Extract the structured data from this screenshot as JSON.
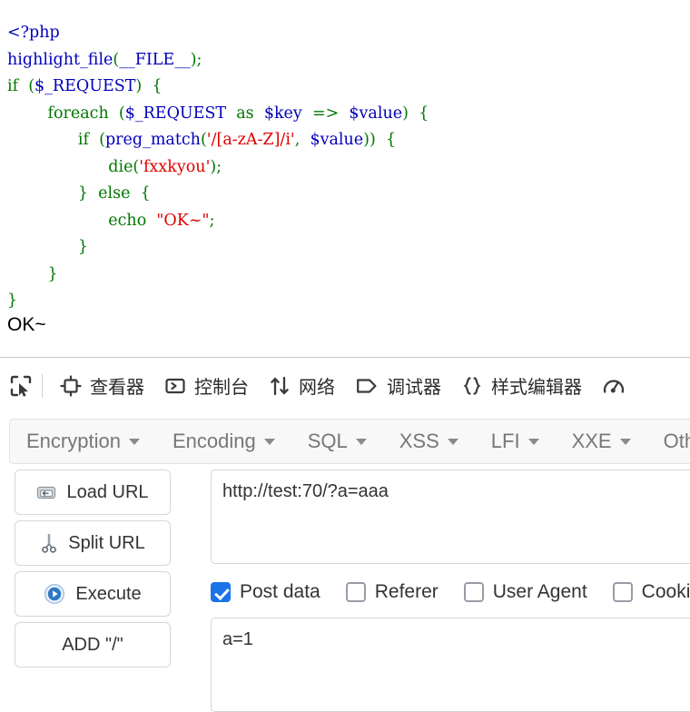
{
  "page": {
    "code_lines": [
      [
        {
          "t": "<?php",
          "c": "tk-default"
        }
      ],
      [
        {
          "t": "highlight_file",
          "c": "tk-fn"
        },
        {
          "t": "(",
          "c": "tk-kw"
        },
        {
          "t": "__FILE__",
          "c": "tk-fn"
        },
        {
          "t": ")",
          "c": "tk-kw"
        },
        {
          "t": ";",
          "c": "tk-kw"
        }
      ],
      [
        {
          "t": "if",
          "c": "tk-kw"
        },
        {
          "t": "  ",
          "c": "tk-kw"
        },
        {
          "t": "(",
          "c": "tk-kw"
        },
        {
          "t": "$_REQUEST",
          "c": "tk-var"
        },
        {
          "t": ")",
          "c": "tk-kw"
        },
        {
          "t": "  ",
          "c": "tk-kw"
        },
        {
          "t": "{",
          "c": "tk-kw"
        }
      ],
      [
        {
          "t": "        ",
          "c": "tk-kw"
        },
        {
          "t": "foreach",
          "c": "tk-kw"
        },
        {
          "t": "  ",
          "c": "tk-kw"
        },
        {
          "t": "(",
          "c": "tk-kw"
        },
        {
          "t": "$_REQUEST",
          "c": "tk-var"
        },
        {
          "t": "  ",
          "c": "tk-kw"
        },
        {
          "t": "as",
          "c": "tk-kw"
        },
        {
          "t": "  ",
          "c": "tk-kw"
        },
        {
          "t": "$key",
          "c": "tk-var"
        },
        {
          "t": "  ",
          "c": "tk-kw"
        },
        {
          "t": "=>",
          "c": "tk-kw"
        },
        {
          "t": "  ",
          "c": "tk-kw"
        },
        {
          "t": "$value",
          "c": "tk-var"
        },
        {
          "t": ")",
          "c": "tk-kw"
        },
        {
          "t": "  ",
          "c": "tk-kw"
        },
        {
          "t": "{",
          "c": "tk-kw"
        }
      ],
      [
        {
          "t": "              ",
          "c": "tk-kw"
        },
        {
          "t": "if",
          "c": "tk-kw"
        },
        {
          "t": "  ",
          "c": "tk-kw"
        },
        {
          "t": "(",
          "c": "tk-kw"
        },
        {
          "t": "preg_match",
          "c": "tk-fn"
        },
        {
          "t": "(",
          "c": "tk-kw"
        },
        {
          "t": "'/[a-zA-Z]/i'",
          "c": "tk-str"
        },
        {
          "t": ",",
          "c": "tk-kw"
        },
        {
          "t": "  ",
          "c": "tk-kw"
        },
        {
          "t": "$value",
          "c": "tk-var"
        },
        {
          "t": "))",
          "c": "tk-kw"
        },
        {
          "t": "  ",
          "c": "tk-kw"
        },
        {
          "t": "{",
          "c": "tk-kw"
        }
      ],
      [
        {
          "t": "                    ",
          "c": "tk-kw"
        },
        {
          "t": "die",
          "c": "tk-kw"
        },
        {
          "t": "(",
          "c": "tk-kw"
        },
        {
          "t": "'fxxkyou'",
          "c": "tk-str"
        },
        {
          "t": ")",
          "c": "tk-kw"
        },
        {
          "t": ";",
          "c": "tk-kw"
        }
      ],
      [
        {
          "t": "              ",
          "c": "tk-kw"
        },
        {
          "t": "}",
          "c": "tk-kw"
        },
        {
          "t": "  ",
          "c": "tk-kw"
        },
        {
          "t": "else",
          "c": "tk-kw"
        },
        {
          "t": "  ",
          "c": "tk-kw"
        },
        {
          "t": "{",
          "c": "tk-kw"
        }
      ],
      [
        {
          "t": "                    ",
          "c": "tk-kw"
        },
        {
          "t": "echo",
          "c": "tk-kw"
        },
        {
          "t": "  ",
          "c": "tk-kw"
        },
        {
          "t": "\"OK~\"",
          "c": "tk-str"
        },
        {
          "t": ";",
          "c": "tk-kw"
        }
      ],
      [
        {
          "t": "              ",
          "c": "tk-kw"
        },
        {
          "t": "}",
          "c": "tk-kw"
        }
      ],
      [
        {
          "t": "        ",
          "c": "tk-kw"
        },
        {
          "t": "}",
          "c": "tk-kw"
        }
      ],
      [
        {
          "t": "}",
          "c": "tk-kw"
        }
      ]
    ],
    "output_text": "OK~"
  },
  "devtools": {
    "picker_icon": "element-picker-icon",
    "tabs": [
      {
        "label": "查看器",
        "icon": "inspector-target-icon",
        "name": "tab-inspector"
      },
      {
        "label": "控制台",
        "icon": "console-chevron-icon",
        "name": "tab-console"
      },
      {
        "label": "网络",
        "icon": "network-arrows-icon",
        "name": "tab-network"
      },
      {
        "label": "调试器",
        "icon": "debugger-tag-icon",
        "name": "tab-debugger"
      },
      {
        "label": "样式编辑器",
        "icon": "style-editor-braces-icon",
        "name": "tab-style-editor"
      },
      {
        "label": "",
        "icon": "performance-gauge-icon",
        "name": "tab-performance"
      }
    ]
  },
  "hackbar": {
    "menus": [
      {
        "label": "Encryption",
        "name": "menu-encryption"
      },
      {
        "label": "Encoding",
        "name": "menu-encoding"
      },
      {
        "label": "SQL",
        "name": "menu-sql"
      },
      {
        "label": "XSS",
        "name": "menu-xss"
      },
      {
        "label": "LFI",
        "name": "menu-lfi"
      },
      {
        "label": "XXE",
        "name": "menu-xxe"
      },
      {
        "label": "Other",
        "name": "menu-other"
      }
    ],
    "buttons": [
      {
        "label": "Load URL",
        "icon": "load-url-disk-icon",
        "name": "load-url-button"
      },
      {
        "label": "Split URL",
        "icon": "split-url-scissors-icon",
        "name": "split-url-button"
      },
      {
        "label": "Execute",
        "icon": "execute-play-icon",
        "name": "execute-button"
      },
      {
        "label": "ADD \"/\"",
        "icon": "",
        "name": "add-slash-button"
      }
    ],
    "url_value": "http://test:70/?a=aaa",
    "url_placeholder": "",
    "post_value": "a=1",
    "post_placeholder": "",
    "checkboxes": [
      {
        "label": "Post data",
        "checked": true,
        "name": "checkbox-post-data"
      },
      {
        "label": "Referer",
        "checked": false,
        "name": "checkbox-referer"
      },
      {
        "label": "User Agent",
        "checked": false,
        "name": "checkbox-user-agent"
      },
      {
        "label": "Cookies",
        "checked": false,
        "name": "checkbox-cookies"
      }
    ]
  },
  "colors": {
    "php_default": "#0000BB",
    "php_keyword": "#007700",
    "php_string": "#DD0000",
    "checkbox_accent": "#1a73e8",
    "menu_text": "#777777"
  }
}
